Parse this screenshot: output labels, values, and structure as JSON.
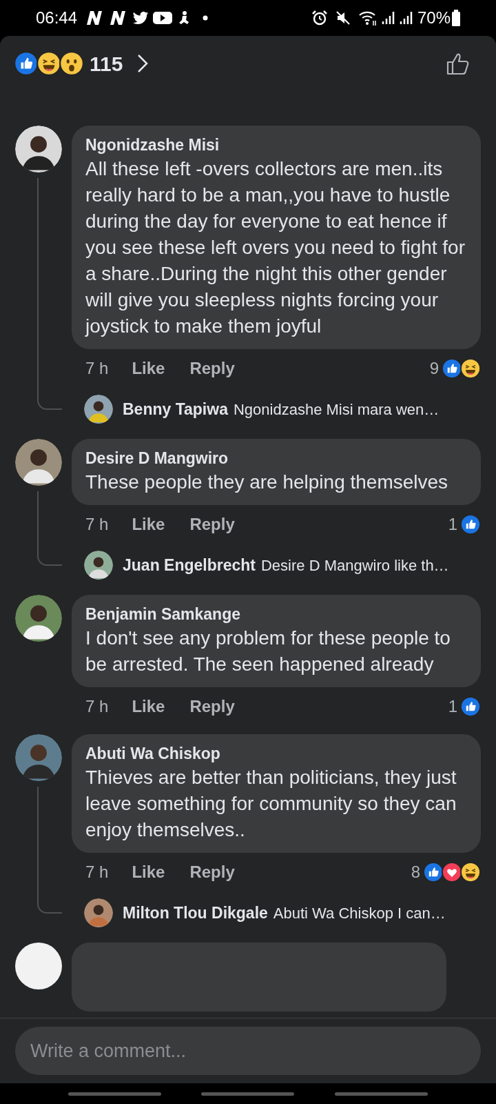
{
  "status_bar": {
    "time": "06:44",
    "battery": "70%"
  },
  "header": {
    "reactions": [
      {
        "kind": "like"
      },
      {
        "kind": "haha"
      },
      {
        "kind": "wow"
      }
    ],
    "count": "115"
  },
  "comments": [
    {
      "author": "Ngonidzashe Misi",
      "text": "All these left -overs collectors are men..its really hard to be a man,,you have to hustle during the day for everyone to eat hence if you see these left overs you need to fight for a share..During the night this other gender will give you sleepless nights forcing your joystick to make them joyful",
      "time": "7 h",
      "like": "Like",
      "reply": "Reply",
      "reaction_count": "9",
      "reactions": [
        {
          "kind": "like"
        },
        {
          "kind": "haha"
        }
      ],
      "reply_preview": {
        "author": "Benny Tapiwa",
        "text": "Ngonidzashe Misi mara wen…"
      }
    },
    {
      "author": "Desire D Mangwiro",
      "text": "These people they are helping themselves",
      "time": "7 h",
      "like": "Like",
      "reply": "Reply",
      "reaction_count": "1",
      "reactions": [
        {
          "kind": "like"
        }
      ],
      "reply_preview": {
        "author": "Juan Engelbrecht",
        "text": "Desire D Mangwiro like th…"
      }
    },
    {
      "author": "Benjamin Samkange",
      "text": "I don't see any problem for these people to be arrested. The seen happened already",
      "time": "7 h",
      "like": "Like",
      "reply": "Reply",
      "reaction_count": "1",
      "reactions": [
        {
          "kind": "like"
        }
      ]
    },
    {
      "author": "Abuti Wa Chiskop",
      "text": "Thieves are better than politicians, they just leave something for community so they can enjoy themselves..",
      "time": "7 h",
      "like": "Like",
      "reply": "Reply",
      "reaction_count": "8",
      "reactions": [
        {
          "kind": "like"
        },
        {
          "kind": "love"
        },
        {
          "kind": "haha"
        }
      ],
      "reply_preview": {
        "author": "Milton Tlou Dikgale",
        "text": "Abuti Wa Chiskop I can…"
      }
    }
  ],
  "composer": {
    "placeholder": "Write a comment..."
  }
}
